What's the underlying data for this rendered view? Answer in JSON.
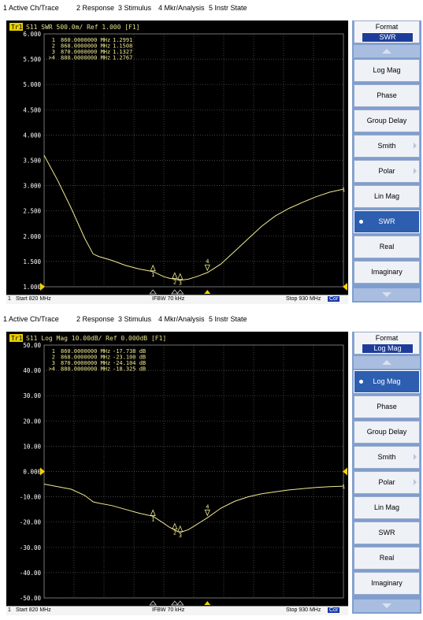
{
  "menu": [
    "1 Active Ch/Trace",
    "2 Response",
    "3 Stimulus",
    "4 Mkr/Analysis",
    "5 Instr State"
  ],
  "panels": [
    {
      "trace_tag": "Tr1",
      "trace_header": "S11  SWR 500.0m/ Ref 1.000 [F1]",
      "y_ticks": [
        "6.000",
        "5.500",
        "5.000",
        "4.500",
        "4.000",
        "3.500",
        "3.000",
        "2.500",
        "2.000",
        "1.500",
        "1.000"
      ],
      "markers": [
        {
          "id": "1",
          "freq": "860.0000000 MHz",
          "value": "1.2991"
        },
        {
          "id": "2",
          "freq": "868.0000000 MHz",
          "value": "1.1508"
        },
        {
          "id": "3",
          "freq": "870.0000000 MHz",
          "value": "1.1327"
        },
        {
          "id": ">4",
          "freq": "880.0000000 MHz",
          "value": "1.2767"
        }
      ],
      "status": {
        "start": "Start 820 MHz",
        "ifbw": "IFBW 70 kHz",
        "stop": "Stop 930 MHz",
        "cor": "Cor"
      },
      "format": {
        "title": "Format",
        "value": "SWR"
      },
      "softkeys": [
        "Log Mag",
        "Phase",
        "Group Delay",
        "Smith",
        "Polar",
        "Lin Mag",
        "SWR",
        "Real",
        "Imaginary"
      ],
      "selected": "SWR",
      "chart_data": {
        "type": "line",
        "ylabel": "",
        "xlabel": "",
        "xlim": [
          820,
          930
        ],
        "ylim": [
          1.0,
          6.0
        ],
        "ref_value": 1.0,
        "series": [
          {
            "values": [
              [
                820,
                3.6
              ],
              [
                825,
                3.1
              ],
              [
                830,
                2.55
              ],
              [
                835,
                1.95
              ],
              [
                838,
                1.65
              ],
              [
                840,
                1.6
              ],
              [
                845,
                1.52
              ],
              [
                850,
                1.42
              ],
              [
                855,
                1.35
              ],
              [
                860,
                1.3
              ],
              [
                864,
                1.2
              ],
              [
                866,
                1.17
              ],
              [
                868,
                1.15
              ],
              [
                870,
                1.13
              ],
              [
                873,
                1.15
              ],
              [
                876,
                1.2
              ],
              [
                880,
                1.28
              ],
              [
                885,
                1.45
              ],
              [
                890,
                1.7
              ],
              [
                895,
                1.95
              ],
              [
                900,
                2.2
              ],
              [
                905,
                2.4
              ],
              [
                910,
                2.55
              ],
              [
                915,
                2.67
              ],
              [
                920,
                2.78
              ],
              [
                925,
                2.87
              ],
              [
                930,
                2.93
              ]
            ]
          }
        ],
        "markers": [
          {
            "x": 860,
            "y": 1.2991,
            "label": "1"
          },
          {
            "x": 868,
            "y": 1.1508,
            "label": "2"
          },
          {
            "x": 870,
            "y": 1.1327,
            "label": "3"
          },
          {
            "x": 880,
            "y": 1.2767,
            "label": "4"
          }
        ]
      }
    },
    {
      "trace_tag": "Tr1",
      "trace_header": "S11  Log Mag 10.00dB/ Ref 0.000dB [F1]",
      "y_ticks": [
        "50.00",
        "40.00",
        "30.00",
        "20.00",
        "10.00",
        "0.000",
        "-10.00",
        "-20.00",
        "-30.00",
        "-40.00",
        "-50.00"
      ],
      "markers": [
        {
          "id": "1",
          "freq": "860.0000000 MHz",
          "value": "-17.738  dB"
        },
        {
          "id": "2",
          "freq": "868.0000000 MHz",
          "value": "-23.100  dB"
        },
        {
          "id": "3",
          "freq": "870.0000000 MHz",
          "value": "-24.104  dB"
        },
        {
          "id": ">4",
          "freq": "880.0000000 MHz",
          "value": "-18.325  dB"
        }
      ],
      "status": {
        "start": "Start 820 MHz",
        "ifbw": "IFBW 70 kHz",
        "stop": "Stop 930 MHz",
        "cor": "Cor"
      },
      "format": {
        "title": "Format",
        "value": "Log Mag"
      },
      "softkeys": [
        "Log Mag",
        "Phase",
        "Group Delay",
        "Smith",
        "Polar",
        "Lin Mag",
        "SWR",
        "Real",
        "Imaginary"
      ],
      "selected": "Log Mag",
      "chart_data": {
        "type": "line",
        "ylabel": "",
        "xlabel": "",
        "xlim": [
          820,
          930
        ],
        "ylim": [
          -50,
          50
        ],
        "ref_value": 0,
        "series": [
          {
            "values": [
              [
                820,
                -5
              ],
              [
                825,
                -6
              ],
              [
                830,
                -7
              ],
              [
                835,
                -9.5
              ],
              [
                838,
                -12
              ],
              [
                840,
                -12.5
              ],
              [
                845,
                -13.5
              ],
              [
                850,
                -15
              ],
              [
                855,
                -16.5
              ],
              [
                860,
                -17.7
              ],
              [
                864,
                -20.5
              ],
              [
                866,
                -22
              ],
              [
                868,
                -23.1
              ],
              [
                870,
                -24.1
              ],
              [
                873,
                -23
              ],
              [
                876,
                -21
              ],
              [
                880,
                -18.3
              ],
              [
                885,
                -14.5
              ],
              [
                890,
                -11.8
              ],
              [
                895,
                -10
              ],
              [
                900,
                -8.8
              ],
              [
                905,
                -8
              ],
              [
                910,
                -7.3
              ],
              [
                915,
                -6.8
              ],
              [
                920,
                -6.3
              ],
              [
                925,
                -6
              ],
              [
                930,
                -5.8
              ]
            ]
          }
        ],
        "markers": [
          {
            "x": 860,
            "y": -17.738,
            "label": "1"
          },
          {
            "x": 868,
            "y": -23.1,
            "label": "2"
          },
          {
            "x": 870,
            "y": -24.104,
            "label": "3"
          },
          {
            "x": 880,
            "y": -18.325,
            "label": "4"
          }
        ]
      }
    }
  ]
}
